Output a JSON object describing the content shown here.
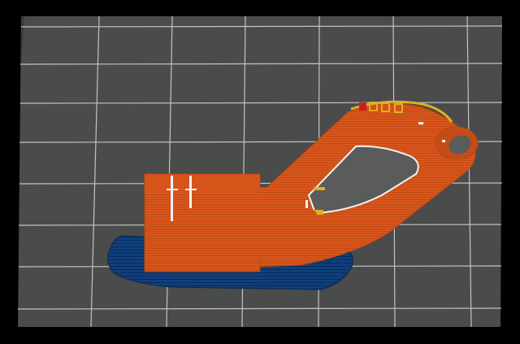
{
  "viewport": {
    "frame_color": "#000000",
    "bed_color": "#4a4b4b",
    "grid_color": "#d9d9d9",
    "skirt_color": "#0d3a73",
    "model_color": "#d9561b",
    "model_shade_color": "#b54515",
    "support_highlight_color": "#f2f2f2",
    "overhang_color": "#e0b020",
    "bridge_color": "#cc1f1f"
  }
}
